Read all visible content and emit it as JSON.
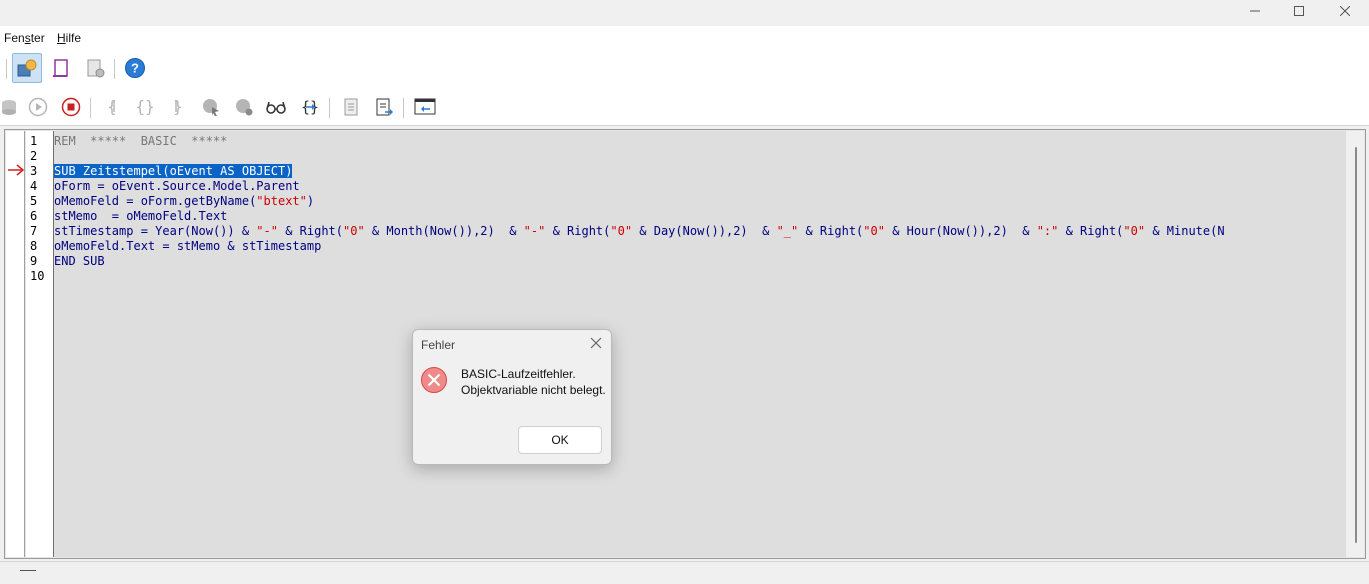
{
  "menubar": {
    "items": [
      {
        "label": "Fenster"
      },
      {
        "label": "Hilfe"
      }
    ]
  },
  "toolbar_top": {
    "icons": [
      "object-catalog-icon",
      "library-icon",
      "module-manage-icon",
      "help-icon"
    ]
  },
  "toolbar_macro": {
    "icons": [
      "compile-icon",
      "run-icon",
      "stop-icon",
      "step-into-icon",
      "step-over-icon",
      "step-out-icon",
      "breakpoint-icon",
      "manage-breakpoints-icon",
      "watch-icon",
      "object-catalog-braces-icon",
      "import-basic-icon",
      "export-basic-icon",
      "insert-dialog-icon"
    ]
  },
  "editor": {
    "line_numbers": [
      "1",
      "2",
      "3",
      "4",
      "5",
      "6",
      "7",
      "8",
      "9",
      "10"
    ],
    "lines": {
      "l1": "REM  *****  BASIC  *****",
      "l2": "",
      "l3": "SUB Zeitstempel(oEvent AS OBJECT)",
      "l4": "oForm = oEvent.Source.Model.Parent",
      "l5a": "oMemoFeld = oForm.getByName(",
      "l5b": "\"btext\"",
      "l5c": ")",
      "l6": "stMemo  = oMemoFeld.Text",
      "l7a": "stTimestamp = Year(Now()) & ",
      "l7b": "\"-\"",
      "l7c": " & Right(",
      "l7d": "\"0\"",
      "l7e": " & Month(Now()),2)  & ",
      "l7f": "\"-\"",
      "l7g": " & Right(",
      "l7h": "\"0\"",
      "l7i": " & Day(Now()),2)  & ",
      "l7j": "\"_\"",
      "l7k": " & Right(",
      "l7l": "\"0\"",
      "l7m": " & Hour(Now()),2)  & ",
      "l7n": "\":\"",
      "l7o": " & Right(",
      "l7p": "\"0\"",
      "l7q": " & Minute(N",
      "l8": "oMemoFeld.Text = stMemo & stTimestamp",
      "l9": "END SUB",
      "l10": ""
    },
    "current_line": "3",
    "colors": {
      "keyword": "#000080",
      "string": "#cc0000",
      "comment": "#777777",
      "selection": "#0a64c8"
    }
  },
  "dialog": {
    "title": "Fehler",
    "message": "BASIC-Laufzeitfehler.\nObjektvariable nicht belegt.",
    "ok_label": "OK",
    "icon": "error-icon"
  }
}
